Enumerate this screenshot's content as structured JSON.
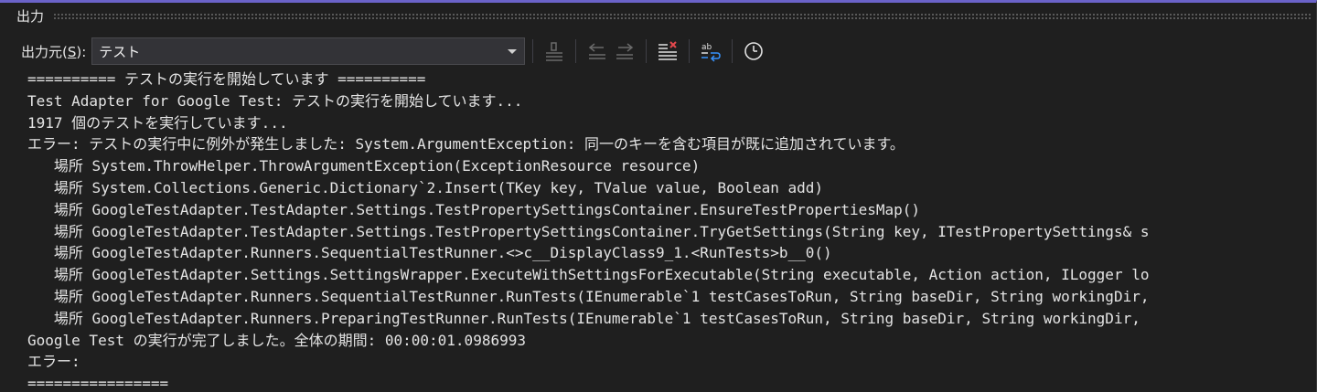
{
  "panel": {
    "title": "出力"
  },
  "toolbar": {
    "source_label_prefix": "出力元(",
    "source_label_key": "S",
    "source_label_suffix": "):",
    "source_value": "テスト",
    "icons": [
      "go-to-line-icon",
      "previous-message-icon",
      "next-message-icon",
      "clear-all-icon",
      "word-wrap-icon",
      "timestamp-icon"
    ]
  },
  "output": {
    "lines": [
      "========== テストの実行を開始しています ==========",
      "Test Adapter for Google Test: テストの実行を開始しています...",
      "1917 個のテストを実行しています...",
      "エラー: テストの実行中に例外が発生しました: System.ArgumentException: 同一のキーを含む項目が既に追加されています。",
      "   場所 System.ThrowHelper.ThrowArgumentException(ExceptionResource resource)",
      "   場所 System.Collections.Generic.Dictionary`2.Insert(TKey key, TValue value, Boolean add)",
      "   場所 GoogleTestAdapter.TestAdapter.Settings.TestPropertySettingsContainer.EnsureTestPropertiesMap()",
      "   場所 GoogleTestAdapter.TestAdapter.Settings.TestPropertySettingsContainer.TryGetSettings(String key, ITestPropertySettings& s",
      "   場所 GoogleTestAdapter.Runners.SequentialTestRunner.<>c__DisplayClass9_1.<RunTests>b__0()",
      "   場所 GoogleTestAdapter.Settings.SettingsWrapper.ExecuteWithSettingsForExecutable(String executable, Action action, ILogger lo",
      "   場所 GoogleTestAdapter.Runners.SequentialTestRunner.RunTests(IEnumerable`1 testCasesToRun, String baseDir, String workingDir,",
      "   場所 GoogleTestAdapter.Runners.PreparingTestRunner.RunTests(IEnumerable`1 testCasesToRun, String baseDir, String workingDir, ",
      "Google Test の実行が完了しました。全体の期間: 00:00:01.0986993",
      "エラー:",
      "================"
    ]
  }
}
